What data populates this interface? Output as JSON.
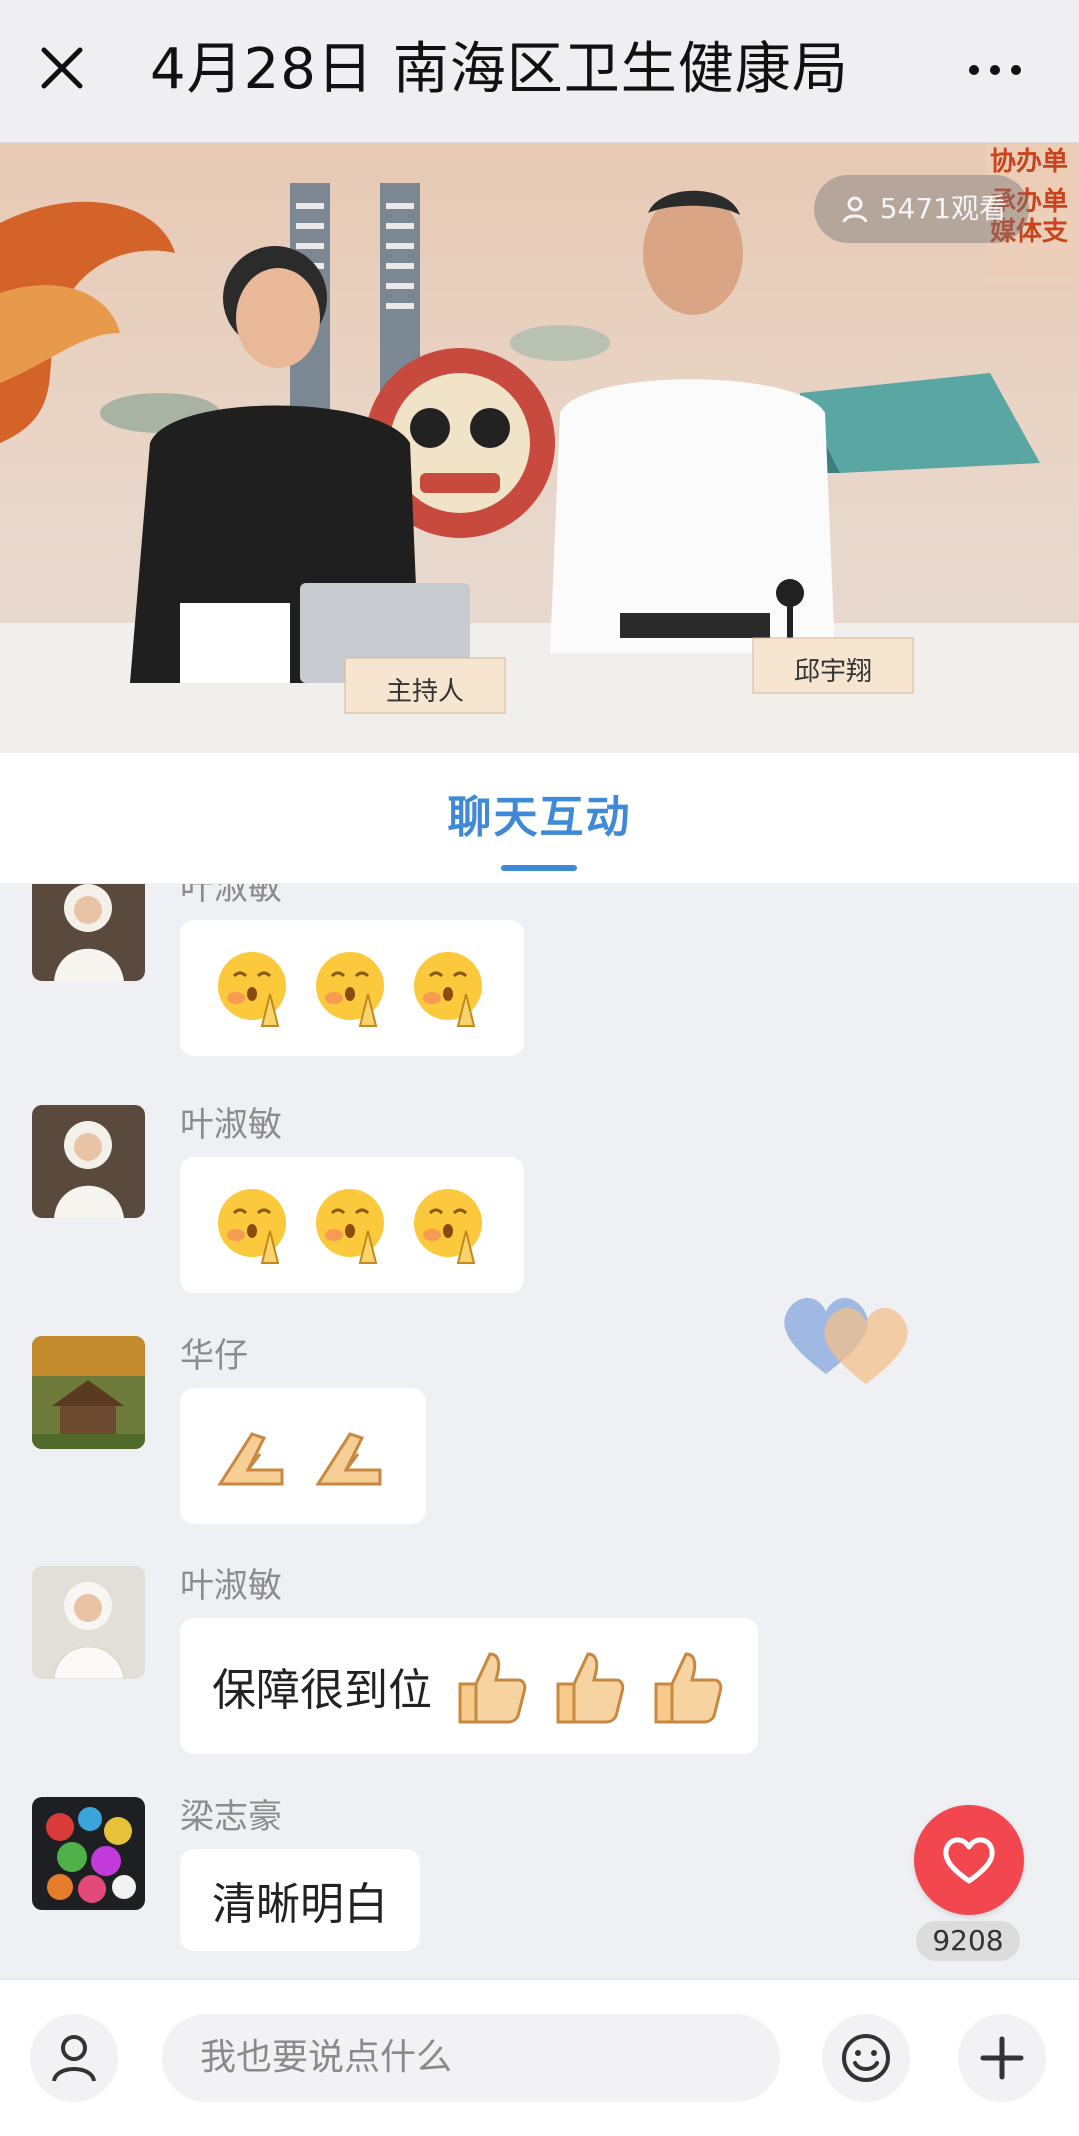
{
  "header": {
    "title": "4月28日 南海区卫生健康局",
    "close_icon": "close-icon",
    "more_icon": "more-icon"
  },
  "video": {
    "viewer_count": "5471观看",
    "nameplate_host": "主持人",
    "nameplate_guest": "邱宇翔",
    "banner_lines": [
      "协办单",
      "承办单",
      "媒体支"
    ]
  },
  "tabs": [
    {
      "label": "聊天互动",
      "active": true
    }
  ],
  "messages": [
    {
      "user": "叶淑敏",
      "text": "",
      "emojis": [
        "pray-face",
        "pray-face",
        "pray-face"
      ]
    },
    {
      "user": "叶淑敏",
      "text": "",
      "emojis": [
        "pray-face",
        "pray-face",
        "pray-face"
      ]
    },
    {
      "user": "华仔",
      "text": "",
      "emojis": [
        "pray-hands",
        "pray-hands"
      ]
    },
    {
      "user": "叶淑敏",
      "text": "保障很到位",
      "emojis": [
        "thumbs-up",
        "thumbs-up",
        "thumbs-up"
      ]
    },
    {
      "user": "梁志豪",
      "text": "清晰明白",
      "emojis": []
    }
  ],
  "like": {
    "count": "9208",
    "icon": "heart-icon"
  },
  "composer": {
    "placeholder": "我也要说点什么",
    "user_icon": "user-icon",
    "emoji_icon": "smile-icon",
    "plus_icon": "plus-icon"
  },
  "colors": {
    "accent": "#3e8ad6",
    "like": "#f2474f",
    "background": "#eff0f4"
  }
}
